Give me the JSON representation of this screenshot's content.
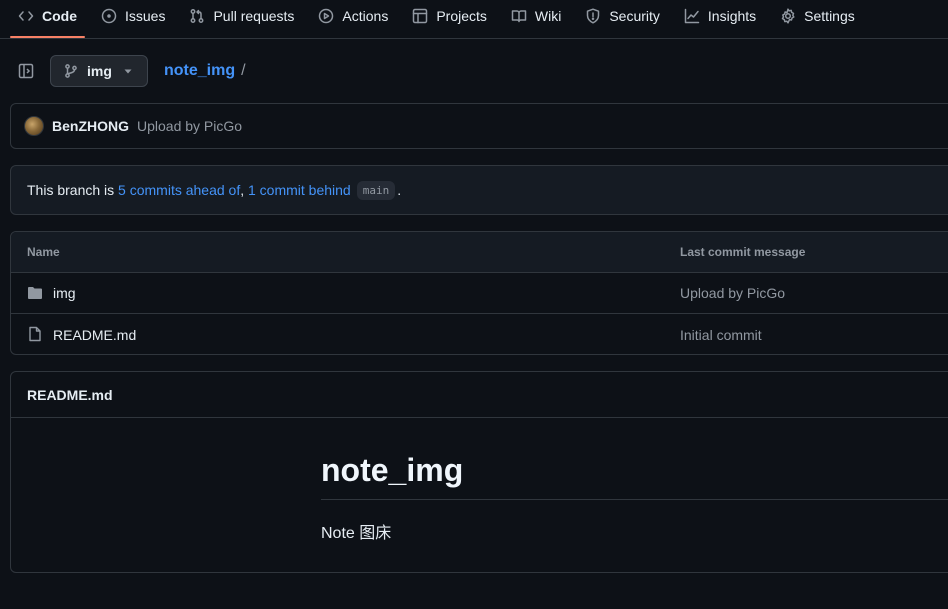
{
  "nav": {
    "tabs": [
      {
        "label": "Code",
        "icon": "code-icon",
        "active": true
      },
      {
        "label": "Issues",
        "icon": "issue-icon"
      },
      {
        "label": "Pull requests",
        "icon": "pull-request-icon"
      },
      {
        "label": "Actions",
        "icon": "play-icon"
      },
      {
        "label": "Projects",
        "icon": "table-icon"
      },
      {
        "label": "Wiki",
        "icon": "book-icon"
      },
      {
        "label": "Security",
        "icon": "shield-icon"
      },
      {
        "label": "Insights",
        "icon": "graph-icon"
      },
      {
        "label": "Settings",
        "icon": "gear-icon"
      }
    ],
    "accent": "#f78166"
  },
  "toolbar": {
    "branch": "img",
    "repo": "note_img",
    "separator": "/"
  },
  "latest_commit": {
    "author": "BenZHONG",
    "message": "Upload by PicGo"
  },
  "branch_status": {
    "prefix": "This branch is ",
    "ahead": "5 commits ahead of",
    "comma": ", ",
    "behind": "1 commit behind",
    "base": "main",
    "suffix": "."
  },
  "files": {
    "headers": {
      "name": "Name",
      "message": "Last commit message"
    },
    "rows": [
      {
        "name": "img",
        "type": "folder",
        "message": "Upload by PicGo"
      },
      {
        "name": "README.md",
        "type": "file",
        "message": "Initial commit"
      }
    ]
  },
  "readme": {
    "filename": "README.md",
    "title": "note_img",
    "text": "Note 图床"
  },
  "colors": {
    "background": "#0d1117",
    "link": "#4493f8",
    "muted": "#9198a1",
    "border": "#30363d"
  }
}
